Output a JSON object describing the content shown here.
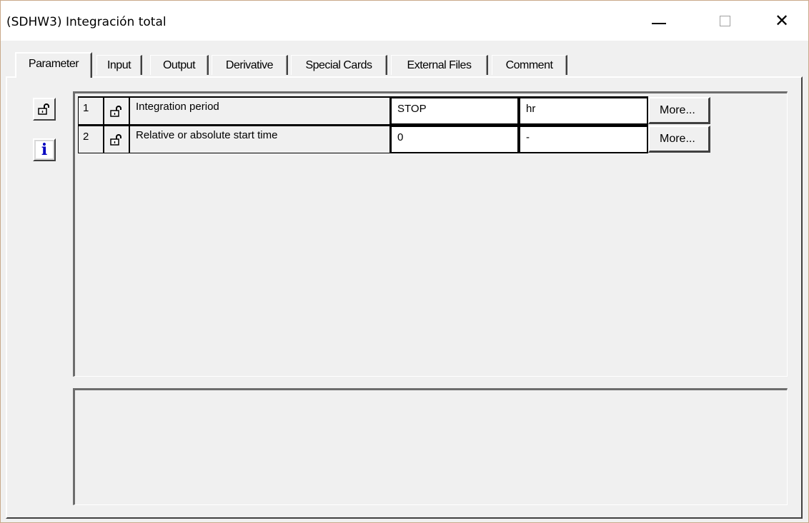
{
  "window": {
    "title": "(SDHW3) Integración total",
    "controls": {
      "minimize": "–",
      "maximize": "□",
      "close": "✕"
    }
  },
  "tabs": [
    {
      "label": "Parameter",
      "active": true
    },
    {
      "label": "Input",
      "active": false
    },
    {
      "label": "Output",
      "active": false
    },
    {
      "label": "Derivative",
      "active": false
    },
    {
      "label": "Special Cards",
      "active": false
    },
    {
      "label": "External Files",
      "active": false
    },
    {
      "label": "Comment",
      "active": false
    }
  ],
  "sidebar": {
    "lock_icon": "unlock-padlock-icon",
    "info_icon": "info-icon",
    "info_glyph": "i"
  },
  "parameters": [
    {
      "index": "1",
      "lock_icon": "unlock-padlock-icon",
      "name": "Integration period",
      "value": "STOP",
      "unit": "hr",
      "more": "More..."
    },
    {
      "index": "2",
      "lock_icon": "unlock-padlock-icon",
      "name": "Relative or absolute start time",
      "value": "0",
      "unit": "-",
      "more": "More..."
    }
  ],
  "description": "",
  "colors": {
    "info_icon_bg": "#ffffff",
    "info_icon_fg": "#0000c0",
    "face": "#f0f0f0"
  }
}
